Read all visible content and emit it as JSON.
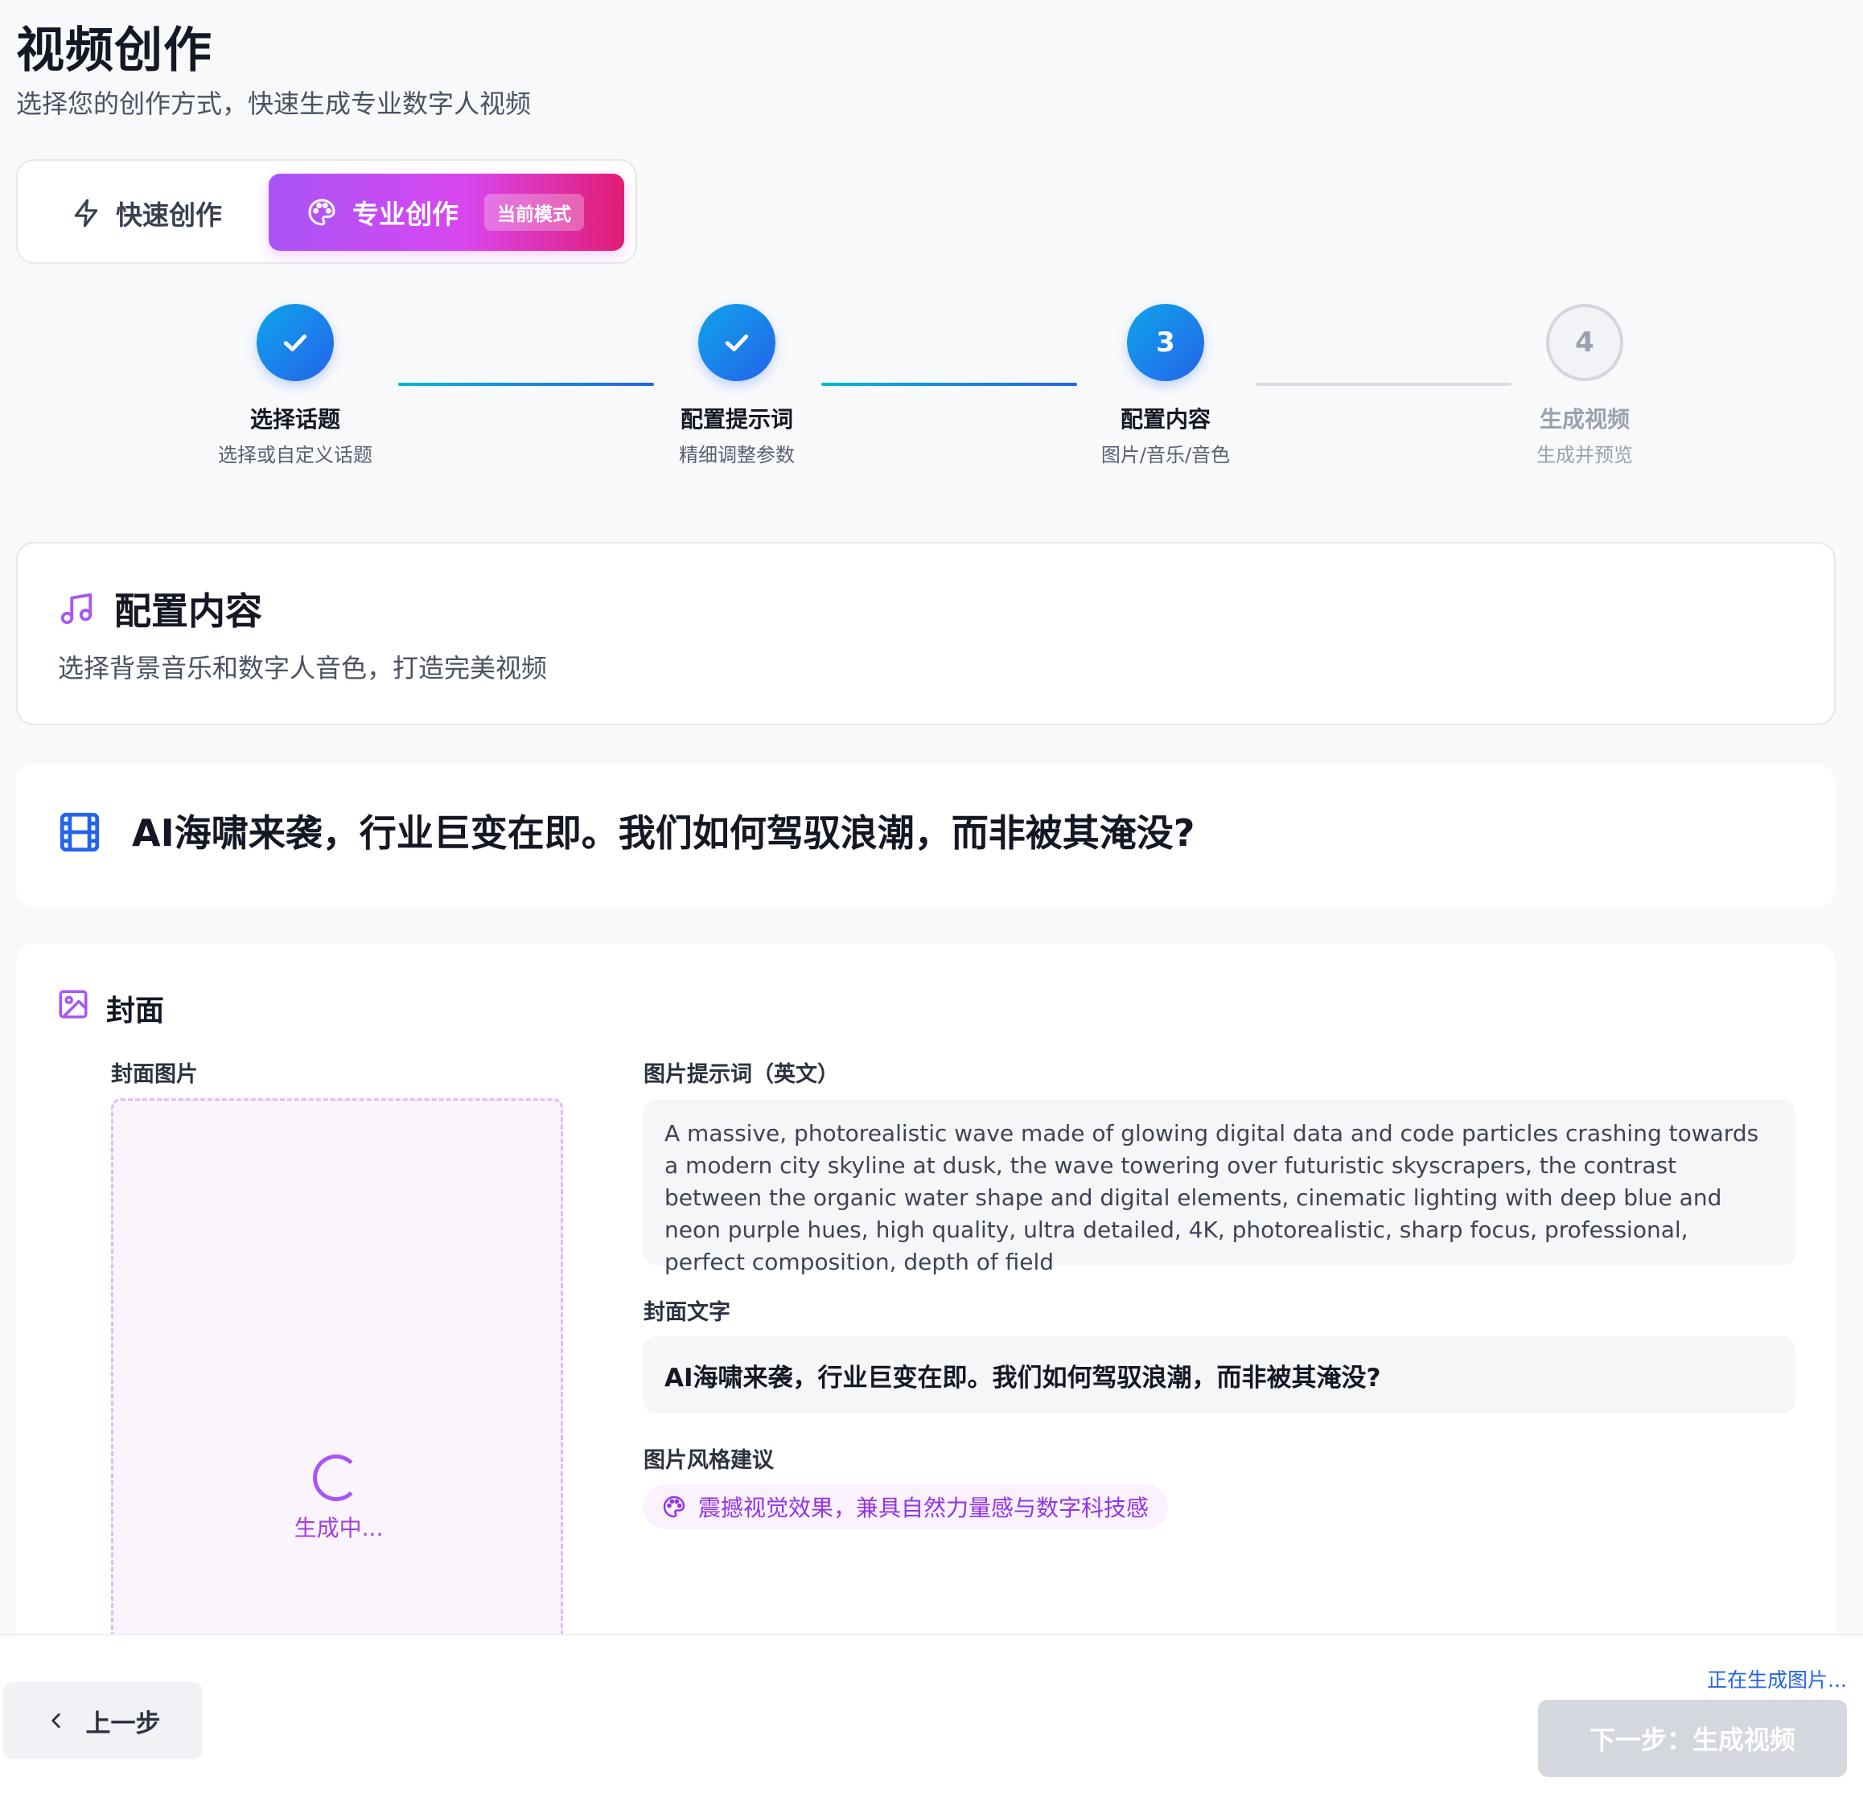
{
  "header": {
    "title": "视频创作",
    "subtitle": "选择您的创作方式，快速生成专业数字人视频"
  },
  "mode_switch": {
    "quick_label": "快速创作",
    "pro_label": "专业创作",
    "current_badge": "当前模式",
    "selected": "pro"
  },
  "steps": [
    {
      "number": "1",
      "title": "选择话题",
      "desc": "选择或自定义话题",
      "status": "done"
    },
    {
      "number": "2",
      "title": "配置提示词",
      "desc": "精细调整参数",
      "status": "done"
    },
    {
      "number": "3",
      "title": "配置内容",
      "desc": "图片/音乐/音色",
      "status": "active"
    },
    {
      "number": "4",
      "title": "生成视频",
      "desc": "生成并预览",
      "status": "pending"
    }
  ],
  "config_card": {
    "icon": "music-icon",
    "title": "配置内容",
    "desc": "选择背景音乐和数字人音色，打造完美视频"
  },
  "topic_card": {
    "icon": "film-icon",
    "title": "AI海啸来袭，行业巨变在即。我们如何驾驭浪潮，而非被其淹没?"
  },
  "cover": {
    "icon": "image-icon",
    "heading": "封面",
    "image_label": "封面图片",
    "generating_text": "生成中...",
    "prompt_label": "图片提示词（英文）",
    "prompt_text": "A massive, photorealistic wave made of glowing digital data and code particles crashing towards a modern city skyline at dusk, the wave towering over futuristic skyscrapers, the contrast between the organic water shape and digital elements, cinematic lighting with deep blue and neon purple hues, high quality, ultra detailed, 4K, photorealistic, sharp focus, professional, perfect composition, depth of field",
    "cover_text_label": "封面文字",
    "cover_text": "AI海啸来袭，行业巨变在即。我们如何驾驭浪潮，而非被其淹没?",
    "style_label": "图片风格建议",
    "style_suggestion": "震撼视觉效果，兼具自然力量感与数字科技感"
  },
  "footer": {
    "prev_label": "上一步",
    "status_text": "正在生成图片...",
    "next_label": "下一步：生成视频",
    "next_disabled": true
  },
  "colors": {
    "accent_blue": "#2563eb",
    "accent_purple": "#a855f7",
    "accent_pink": "#e11d74"
  }
}
